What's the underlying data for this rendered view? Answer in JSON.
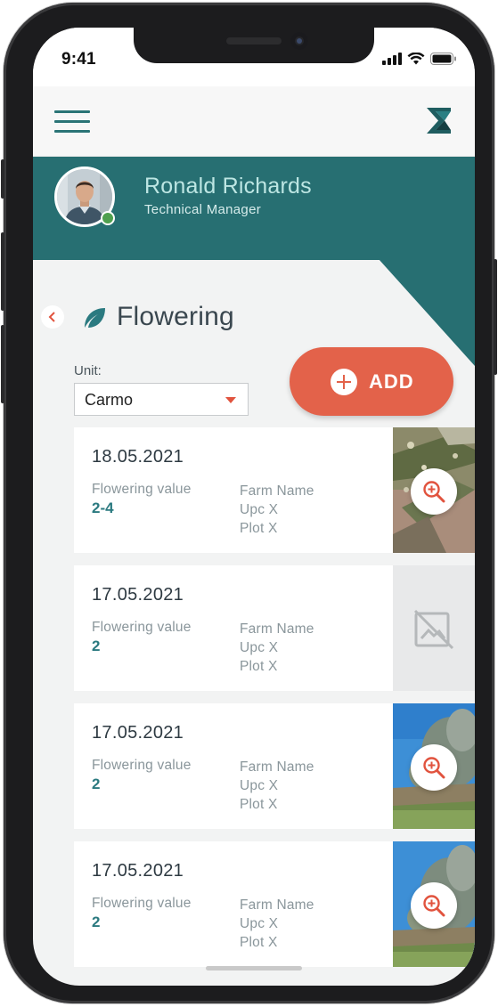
{
  "status_bar": {
    "time": "9:41"
  },
  "user": {
    "name": "Ronald Richards",
    "role": "Technical Manager"
  },
  "page": {
    "title": "Flowering"
  },
  "unit": {
    "label": "Unit:",
    "selected": "Carmo"
  },
  "add_button": {
    "label": "ADD"
  },
  "records": [
    {
      "date": "18.05.2021",
      "value_label": "Flowering value",
      "value": "2-4",
      "farm": "Farm Name",
      "upc": "Upc X",
      "plot": "Plot X",
      "image": "olive-flowers-photo"
    },
    {
      "date": "17.05.2021",
      "value_label": "Flowering value",
      "value": "2",
      "farm": "Farm Name",
      "upc": "Upc X",
      "plot": "Plot X",
      "image": "no-image-placeholder"
    },
    {
      "date": "17.05.2021",
      "value_label": "Flowering value",
      "value": "2",
      "farm": "Farm Name",
      "upc": "Upc X",
      "plot": "Plot X",
      "image": "olive-grove-photo"
    },
    {
      "date": "17.05.2021",
      "value_label": "Flowering value",
      "value": "2",
      "farm": "Farm Name",
      "upc": "Upc X",
      "plot": "Plot X",
      "image": "olive-grove-photo"
    }
  ],
  "colors": {
    "primary": "#276f72",
    "accent": "#e3624a",
    "background": "#f2f3f3"
  },
  "icons": [
    "menu-icon",
    "app-logo-icon",
    "back-chevron-icon",
    "leaf-icon",
    "plus-icon",
    "zoom-in-icon",
    "no-image-icon",
    "signal-icon",
    "wifi-icon",
    "battery-icon"
  ]
}
